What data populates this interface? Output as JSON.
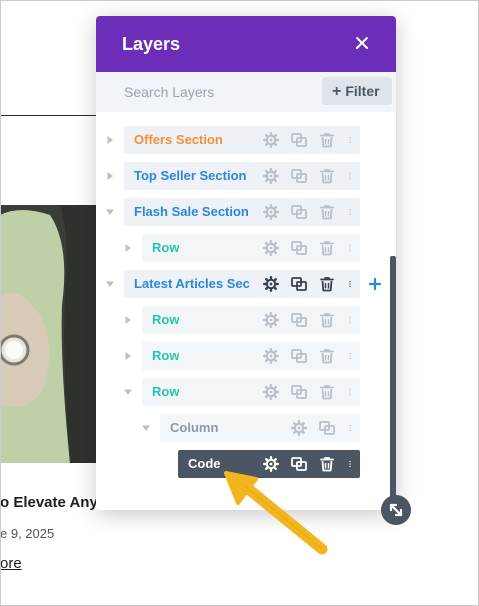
{
  "background": {
    "title": "o Elevate Any",
    "date": "e 9, 2025",
    "read_more": "ore"
  },
  "panel": {
    "title": "Layers",
    "close_icon": "close-icon",
    "search_placeholder": "Search Layers",
    "filter_label": "Filter",
    "colors": {
      "header": "#6c2eb9",
      "section": "#2b87da",
      "row": "#29c4a9",
      "column": "#8e99a6",
      "module_bg": "#4b5563",
      "disabled_section": "#f38f3c",
      "add": "#2b87da"
    }
  },
  "layers": [
    {
      "label": "Offers Section",
      "kind": "section",
      "state": "collapsed",
      "disabled": true
    },
    {
      "label": "Top Seller Section",
      "kind": "section",
      "state": "collapsed"
    },
    {
      "label": "Flash Sale Section",
      "kind": "section",
      "state": "expanded"
    },
    {
      "label": "Row",
      "kind": "row",
      "state": "collapsed"
    },
    {
      "label": "Latest Articles Sect...",
      "kind": "section",
      "state": "expanded",
      "hovered": true
    },
    {
      "label": "Row",
      "kind": "row",
      "state": "collapsed"
    },
    {
      "label": "Row",
      "kind": "row",
      "state": "collapsed"
    },
    {
      "label": "Row",
      "kind": "row",
      "state": "expanded"
    },
    {
      "label": "Column",
      "kind": "column",
      "state": "expanded"
    },
    {
      "label": "Code",
      "kind": "module",
      "selected": true
    }
  ],
  "icons": {
    "settings": "gear-icon",
    "duplicate": "duplicate-icon",
    "delete": "trash-icon",
    "more": "more-dots-icon",
    "add": "plus-icon",
    "resize": "resize-icon"
  }
}
